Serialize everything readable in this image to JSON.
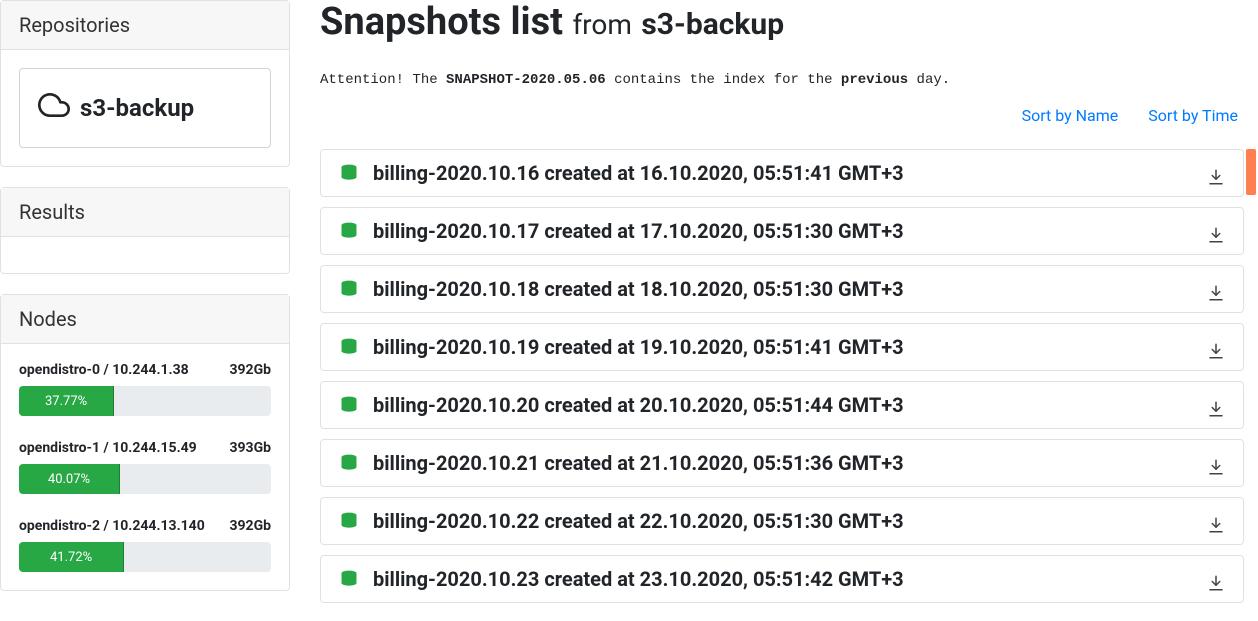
{
  "sidebar": {
    "repositories": {
      "header": "Repositories",
      "items": [
        "s3-backup"
      ]
    },
    "results": {
      "header": "Results"
    },
    "nodes": {
      "header": "Nodes",
      "list": [
        {
          "name": "opendistro-0 / 10.244.1.38",
          "size": "392Gb",
          "pct": 37.77,
          "pct_label": "37.77%"
        },
        {
          "name": "opendistro-1 / 10.244.15.49",
          "size": "393Gb",
          "pct": 40.07,
          "pct_label": "40.07%"
        },
        {
          "name": "opendistro-2 / 10.244.13.140",
          "size": "392Gb",
          "pct": 41.72,
          "pct_label": "41.72%"
        }
      ]
    }
  },
  "main": {
    "title_prefix": "Snapshots list",
    "title_from": "from",
    "title_repo": "s3-backup",
    "notice_pre": "Attention! The ",
    "notice_code": "SNAPSHOT-2020.05.06",
    "notice_mid": " contains the index for the ",
    "notice_strong": "previous",
    "notice_post": " day.",
    "sort": {
      "name": "Sort by Name",
      "time": "Sort by Time"
    },
    "snapshots": [
      {
        "name": "billing-2020.10.16",
        "created": "16.10.2020, 05:51:41 GMT+3"
      },
      {
        "name": "billing-2020.10.17",
        "created": "17.10.2020, 05:51:30 GMT+3"
      },
      {
        "name": "billing-2020.10.18",
        "created": "18.10.2020, 05:51:30 GMT+3"
      },
      {
        "name": "billing-2020.10.19",
        "created": "19.10.2020, 05:51:41 GMT+3"
      },
      {
        "name": "billing-2020.10.20",
        "created": "20.10.2020, 05:51:44 GMT+3"
      },
      {
        "name": "billing-2020.10.21",
        "created": "21.10.2020, 05:51:36 GMT+3"
      },
      {
        "name": "billing-2020.10.22",
        "created": "22.10.2020, 05:51:30 GMT+3"
      },
      {
        "name": "billing-2020.10.23",
        "created": "23.10.2020, 05:51:42 GMT+3"
      }
    ],
    "created_label": "created at"
  }
}
